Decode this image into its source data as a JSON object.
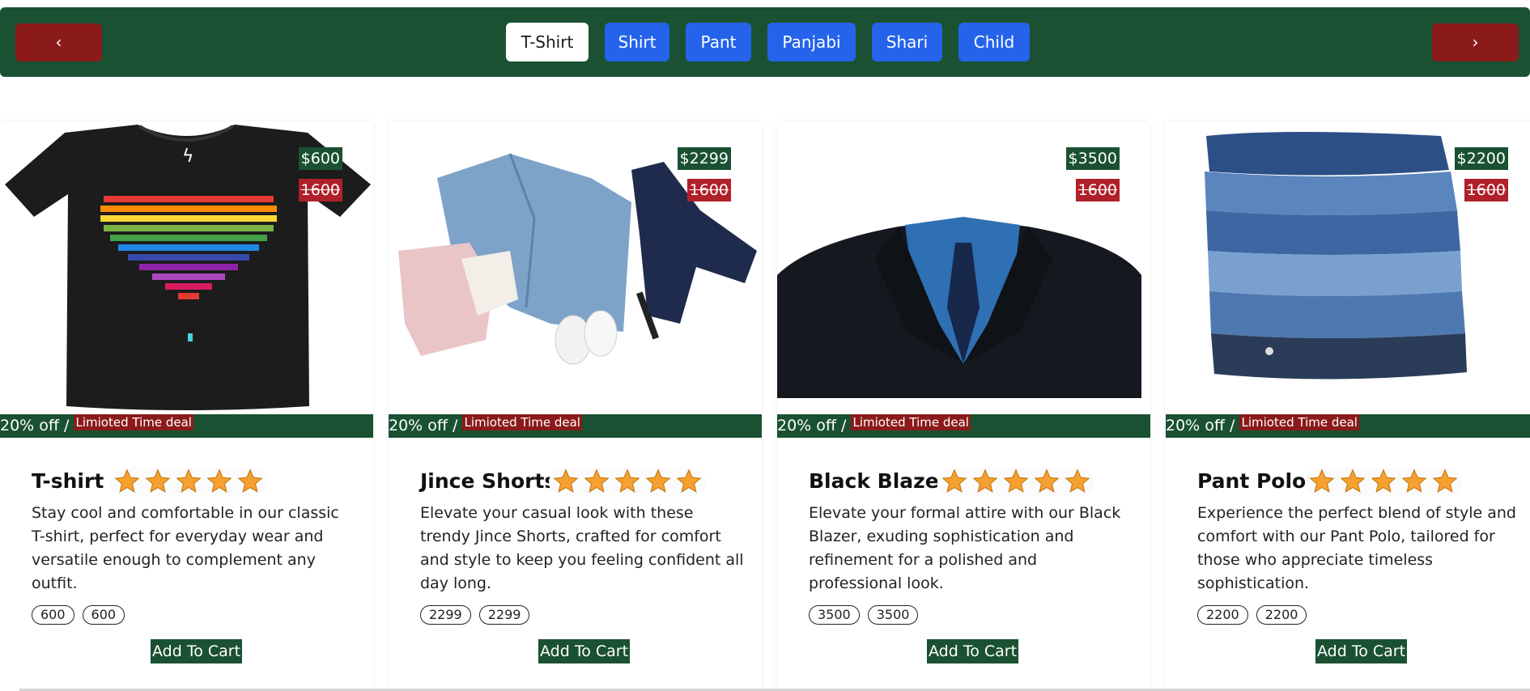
{
  "nav": {
    "prev_label": "‹",
    "next_label": "›"
  },
  "tabs": [
    {
      "label": "T-Shirt",
      "active": true
    },
    {
      "label": "Shirt",
      "active": false
    },
    {
      "label": "Pant",
      "active": false
    },
    {
      "label": "Panjabi",
      "active": false
    },
    {
      "label": "Shari",
      "active": false
    },
    {
      "label": "Child",
      "active": false
    }
  ],
  "products": [
    {
      "title": "T-shirt",
      "price": "$600",
      "old_price": "1600",
      "discount": "20% off /",
      "deal": "Limioted Time deal",
      "rating": 5,
      "description": "Stay cool and comfortable in our classic T-shirt, perfect for everyday wear and versatile enough to complement any outfit.",
      "pills": [
        "600",
        "600"
      ],
      "cart_label": "Add To Cart",
      "image": "black-tshirt-image"
    },
    {
      "title": "Jince Shorts",
      "price": "$2299",
      "old_price": "1600",
      "discount": "20% off /",
      "deal": "Limioted Time deal",
      "rating": 5,
      "description": "Elevate your casual look with these trendy Jince Shorts, crafted for comfort and style to keep you feeling confident all day long.",
      "pills": [
        "2299",
        "2299"
      ],
      "cart_label": "Add To Cart",
      "image": "denim-outfit-image"
    },
    {
      "title": "Black Blazer",
      "price": "$3500",
      "old_price": "1600",
      "discount": "20% off /",
      "deal": "Limioted Time deal",
      "rating": 5,
      "description": "Elevate your formal attire with our Black Blazer, exuding sophistication and refinement for a polished and professional look.",
      "pills": [
        "3500",
        "3500"
      ],
      "cart_label": "Add To Cart",
      "image": "black-blazer-image"
    },
    {
      "title": "Pant Polo",
      "price": "$2200",
      "old_price": "1600",
      "discount": "20% off /",
      "deal": "Limioted Time deal",
      "rating": 5,
      "description": "Experience the perfect blend of style and comfort with our Pant Polo, tailored for those who appreciate timeless sophistication.",
      "pills": [
        "2200",
        "2200"
      ],
      "cart_label": "Add To Cart",
      "image": "folded-jeans-image"
    }
  ],
  "colors": {
    "brand_green": "#1a5132",
    "nav_red": "#8b1a1a",
    "tab_blue": "#2563eb",
    "old_price_red": "#b0202a",
    "star_orange": "#f5a031"
  }
}
